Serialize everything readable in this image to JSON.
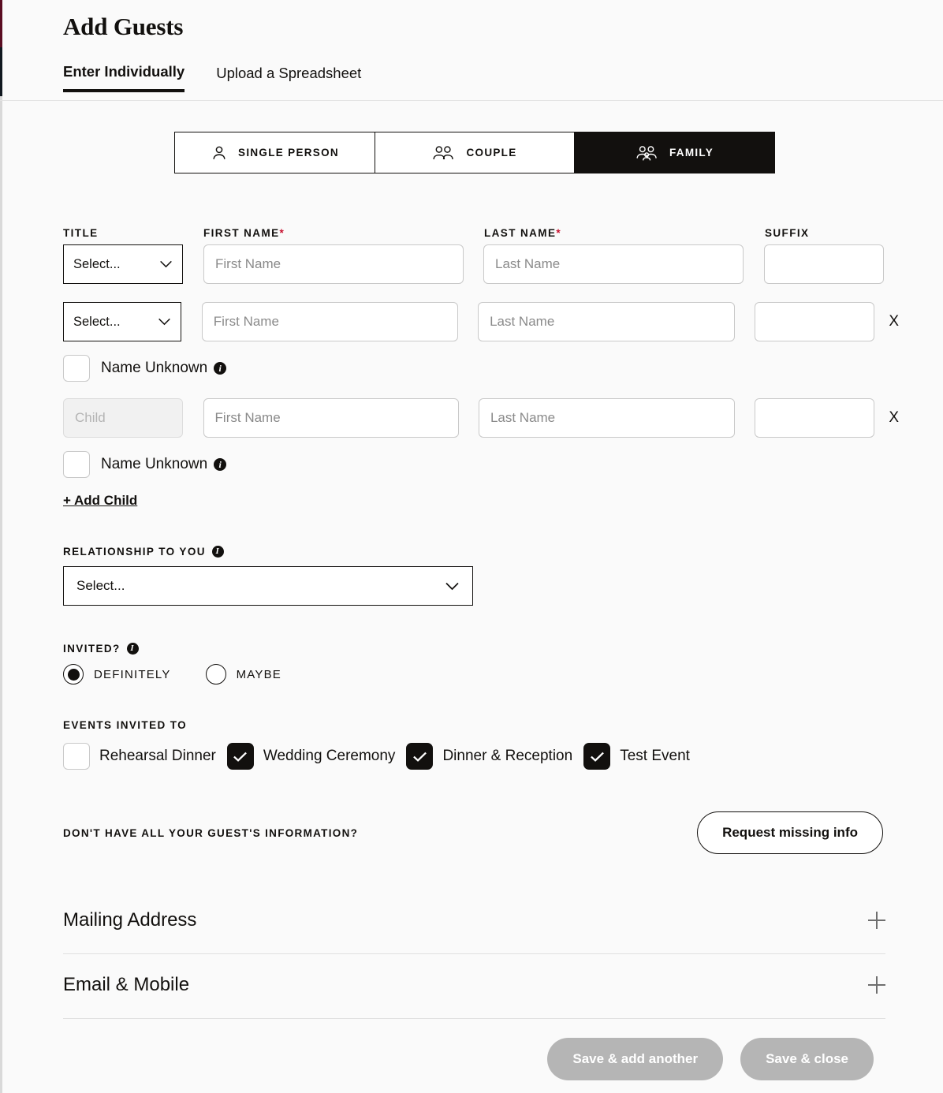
{
  "header": {
    "title": "Add Guests",
    "tabs": [
      {
        "label": "Enter Individually",
        "active": true
      },
      {
        "label": "Upload a Spreadsheet",
        "active": false
      }
    ]
  },
  "guest_type": {
    "options": [
      {
        "label": "SINGLE PERSON",
        "icon": "single-person-icon",
        "selected": false
      },
      {
        "label": "COUPLE",
        "icon": "couple-icon",
        "selected": false
      },
      {
        "label": "FAMILY",
        "icon": "family-icon",
        "selected": true
      }
    ]
  },
  "name_fields": {
    "labels": {
      "title": "TITLE",
      "first_name": "FIRST NAME",
      "last_name": "LAST NAME",
      "suffix": "SUFFIX",
      "required_mark": "*"
    },
    "placeholders": {
      "title_select": "Select...",
      "first_name": "First Name",
      "last_name": "Last Name",
      "suffix": "",
      "child": "Child"
    },
    "rows": [
      {
        "title_value": "Select...",
        "first_name": "",
        "last_name": "",
        "suffix": "",
        "removable": false
      },
      {
        "title_value": "Select...",
        "first_name": "",
        "last_name": "",
        "suffix": "",
        "removable": true
      },
      {
        "title_value": "Child",
        "first_name": "",
        "last_name": "",
        "suffix": "",
        "removable": true,
        "disabled_title": true
      }
    ],
    "remove_label": "X",
    "name_unknown_label": "Name Unknown",
    "name_unknown_checked": false,
    "add_child_label": "+ Add Child"
  },
  "relationship": {
    "label": "RELATIONSHIP TO YOU",
    "value": "Select..."
  },
  "invited": {
    "label": "INVITED?",
    "options": [
      {
        "label": "DEFINITELY",
        "selected": true
      },
      {
        "label": "MAYBE",
        "selected": false
      }
    ]
  },
  "events": {
    "label": "EVENTS INVITED TO",
    "items": [
      {
        "label": "Rehearsal Dinner",
        "checked": false
      },
      {
        "label": "Wedding Ceremony",
        "checked": true
      },
      {
        "label": "Dinner & Reception",
        "checked": true
      },
      {
        "label": "Test Event",
        "checked": true
      }
    ]
  },
  "request_info": {
    "label": "DON'T HAVE ALL YOUR GUEST'S INFORMATION?",
    "button": "Request missing info"
  },
  "accordions": [
    {
      "title": "Mailing Address",
      "expanded": false
    },
    {
      "title": "Email & Mobile",
      "expanded": false
    }
  ],
  "footer": {
    "save_add_another": "Save & add another",
    "save_close": "Save & close"
  },
  "colors": {
    "accent": "#12100e",
    "required": "#c8102e",
    "disabled_button": "#b5b5b5",
    "background": "#fafafa"
  }
}
